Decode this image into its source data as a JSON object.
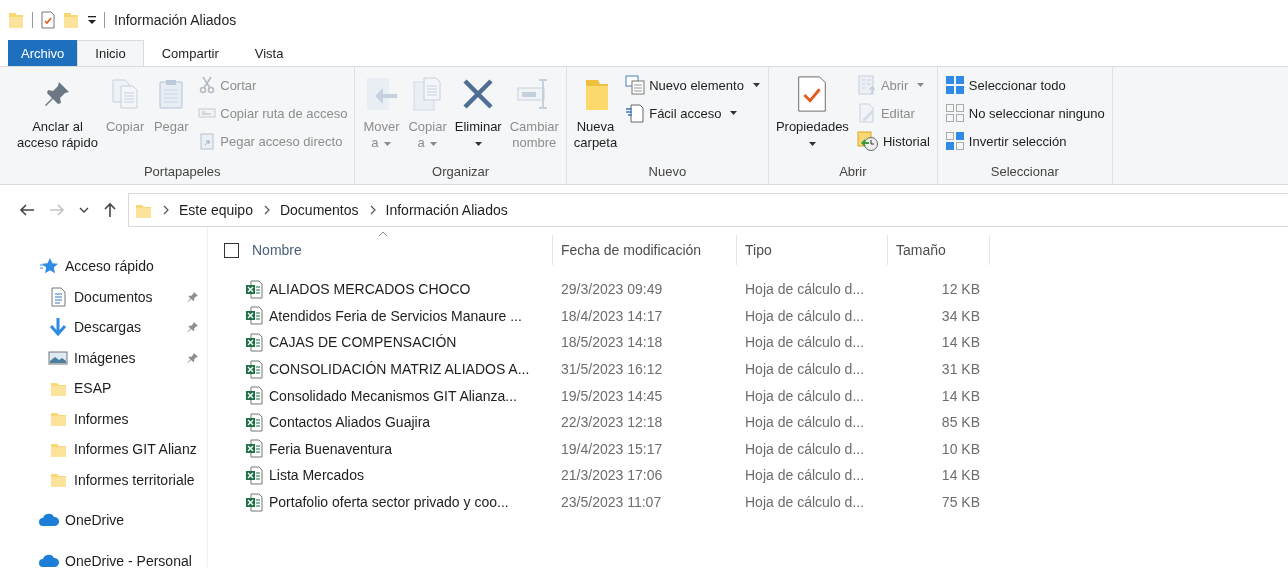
{
  "window": {
    "title": "Información Aliados"
  },
  "tabs": [
    {
      "label": "Archivo",
      "kind": "file",
      "selected": false
    },
    {
      "label": "Inicio",
      "kind": "tab",
      "selected": true
    },
    {
      "label": "Compartir",
      "kind": "tab",
      "selected": false
    },
    {
      "label": "Vista",
      "kind": "tab",
      "selected": false
    }
  ],
  "ribbon": {
    "groups": [
      {
        "label": "Portapapeles",
        "items": [
          {
            "kind": "large",
            "label": "Anclar al\nacceso rápido",
            "disabled": false,
            "dropdown": false
          },
          {
            "kind": "large",
            "label": "Copiar",
            "disabled": true,
            "dropdown": false
          },
          {
            "kind": "large",
            "label": "Pegar",
            "disabled": true,
            "dropdown": false
          },
          {
            "kind": "small",
            "label": "Cortar",
            "disabled": true,
            "dropdown": false
          },
          {
            "kind": "small",
            "label": "Copiar ruta de acceso",
            "disabled": true,
            "dropdown": false
          },
          {
            "kind": "small",
            "label": "Pegar acceso directo",
            "disabled": true,
            "dropdown": false
          }
        ]
      },
      {
        "label": "Organizar",
        "items": [
          {
            "kind": "large",
            "label": "Mover\na",
            "disabled": true,
            "dropdown": true
          },
          {
            "kind": "large",
            "label": "Copiar\na",
            "disabled": true,
            "dropdown": true
          },
          {
            "kind": "large",
            "label": "Eliminar",
            "disabled": false,
            "dropdown": true
          },
          {
            "kind": "large",
            "label": "Cambiar\nnombre",
            "disabled": true,
            "dropdown": false
          }
        ]
      },
      {
        "label": "Nuevo",
        "items": [
          {
            "kind": "large",
            "label": "Nueva\ncarpeta",
            "disabled": false,
            "dropdown": false
          },
          {
            "kind": "small",
            "label": "Nuevo elemento",
            "disabled": false,
            "dropdown": true
          },
          {
            "kind": "small",
            "label": "Fácil acceso",
            "disabled": false,
            "dropdown": true
          }
        ]
      },
      {
        "label": "Abrir",
        "items": [
          {
            "kind": "large",
            "label": "Propiedades",
            "disabled": false,
            "dropdown": true
          },
          {
            "kind": "small",
            "label": "Abrir",
            "disabled": true,
            "dropdown": true
          },
          {
            "kind": "small",
            "label": "Editar",
            "disabled": true,
            "dropdown": false
          },
          {
            "kind": "small",
            "label": "Historial",
            "disabled": false,
            "dropdown": false
          }
        ]
      },
      {
        "label": "Seleccionar",
        "items": [
          {
            "kind": "small",
            "label": "Seleccionar todo",
            "disabled": false,
            "dropdown": false
          },
          {
            "kind": "small",
            "label": "No seleccionar ninguno",
            "disabled": false,
            "dropdown": false
          },
          {
            "kind": "small",
            "label": "Invertir selección",
            "disabled": false,
            "dropdown": false
          }
        ]
      }
    ]
  },
  "navigation": [
    {
      "kind": "back",
      "disabled": false
    },
    {
      "kind": "forward",
      "disabled": true
    },
    {
      "kind": "recent",
      "disabled": false
    },
    {
      "kind": "up",
      "disabled": false
    }
  ],
  "breadcrumb": [
    "Este equipo",
    "Documentos",
    "Información Aliados"
  ],
  "sidebar": {
    "items": [
      {
        "label": "Acceso rápido",
        "children": [
          {
            "label": "Documentos",
            "pinned": true
          },
          {
            "label": "Descargas",
            "pinned": true
          },
          {
            "label": "Imágenes",
            "pinned": true
          },
          {
            "label": "ESAP",
            "pinned": false
          },
          {
            "label": "Informes",
            "pinned": false
          },
          {
            "label": "Informes GIT Alianz",
            "pinned": false
          },
          {
            "label": "Informes territoriale",
            "pinned": false
          }
        ]
      },
      {
        "label": "OneDrive"
      },
      {
        "label": "OneDrive - Personal"
      }
    ]
  },
  "table": {
    "select_all": {
      "checked": false
    },
    "columns": [
      "Nombre",
      "Fecha de modificación",
      "Tipo",
      "Tamaño"
    ],
    "rows": [
      {
        "name": "ALIADOS MERCADOS CHOCO",
        "date": "29/3/2023 09:49",
        "type": "Hoja de cálculo d...",
        "size": "12 KB"
      },
      {
        "name": "Atendidos Feria de Servicios Manaure ...",
        "date": "18/4/2023 14:17",
        "type": "Hoja de cálculo d...",
        "size": "34 KB"
      },
      {
        "name": "CAJAS DE COMPENSACIÓN",
        "date": "18/5/2023 14:18",
        "type": "Hoja de cálculo d...",
        "size": "14 KB"
      },
      {
        "name": "CONSOLIDACIÓN MATRIZ ALIADOS A...",
        "date": "31/5/2023 16:12",
        "type": "Hoja de cálculo d...",
        "size": "31 KB"
      },
      {
        "name": "Consolidado Mecanismos GIT Alianza...",
        "date": "19/5/2023 14:45",
        "type": "Hoja de cálculo d...",
        "size": "14 KB"
      },
      {
        "name": "Contactos Aliados Guajira",
        "date": "22/3/2023 12:18",
        "type": "Hoja de cálculo d...",
        "size": "85 KB"
      },
      {
        "name": "Feria Buenaventura",
        "date": "19/4/2023 15:17",
        "type": "Hoja de cálculo d...",
        "size": "10 KB"
      },
      {
        "name": "Lista Mercados",
        "date": "21/3/2023 17:06",
        "type": "Hoja de cálculo d...",
        "size": "14 KB"
      },
      {
        "name": "Portafolio oferta sector privado y coo...",
        "date": "23/5/2023 11:07",
        "type": "Hoja de cálculo d...",
        "size": "75 KB"
      }
    ]
  }
}
